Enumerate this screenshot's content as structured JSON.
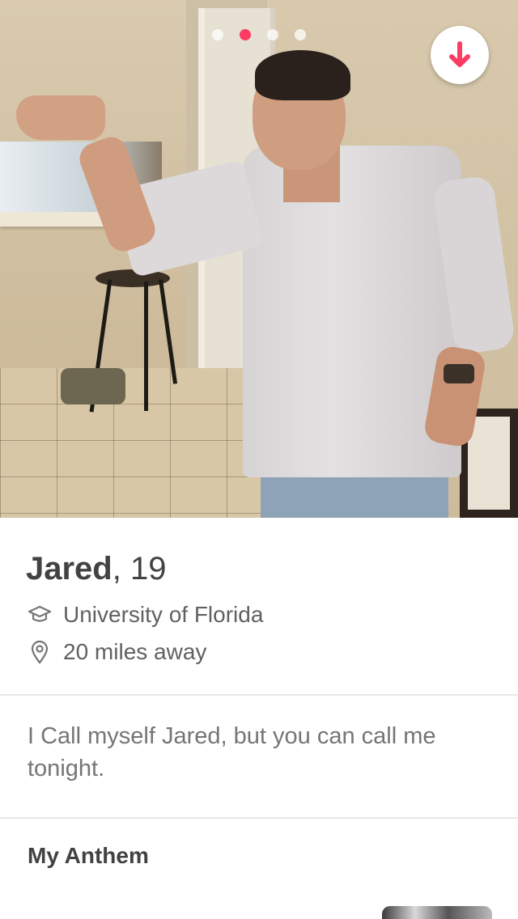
{
  "photo": {
    "description_icon": "profile-photo",
    "page_count": 4,
    "active_page": 2
  },
  "colors": {
    "accent": "#fd3c63",
    "text_primary": "#424242",
    "text_secondary": "#757575",
    "divider": "#e8e8e8"
  },
  "collapse_button": {
    "icon": "arrow-down-icon"
  },
  "profile": {
    "name": "Jared",
    "separator": ",",
    "age": "19",
    "school": "University of Florida",
    "school_icon": "graduation-cap-icon",
    "distance": "20 miles away",
    "distance_icon": "location-pin-icon",
    "bio": "I Call myself Jared, but you can call me tonight."
  },
  "anthem": {
    "heading": "My Anthem"
  }
}
